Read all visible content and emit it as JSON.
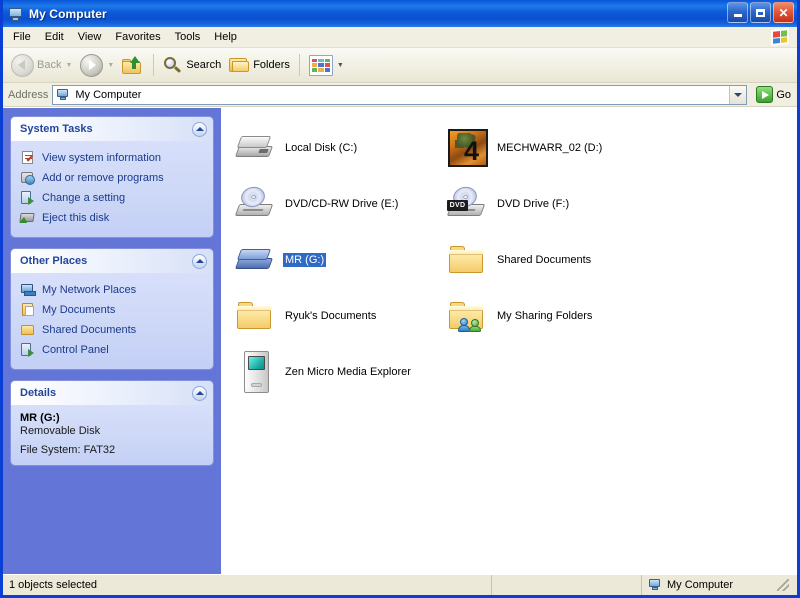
{
  "window": {
    "title": "My Computer",
    "title_icon": "my-computer-icon",
    "minimize_label": "Minimize",
    "maximize_label": "Maximize",
    "close_label": "Close"
  },
  "menubar": {
    "items": [
      {
        "label": "File"
      },
      {
        "label": "Edit"
      },
      {
        "label": "View"
      },
      {
        "label": "Favorites"
      },
      {
        "label": "Tools"
      },
      {
        "label": "Help"
      }
    ],
    "logo": "windows-flag-icon"
  },
  "toolbar": {
    "back_label": "Back",
    "back_icon": "back-arrow-icon",
    "forward_icon": "forward-arrow-icon",
    "up_icon": "up-folder-icon",
    "search_label": "Search",
    "search_icon": "search-icon",
    "folders_label": "Folders",
    "folders_icon": "folders-icon",
    "views_icon": "views-icon"
  },
  "addressbar": {
    "label": "Address",
    "value": "My Computer",
    "icon": "my-computer-icon",
    "dropdown_icon": "chevron-down-icon",
    "go_label": "Go",
    "go_icon": "go-arrow-icon"
  },
  "sidebar": {
    "panels": [
      {
        "title": "System Tasks",
        "collapse_icon": "chevron-up-icon",
        "items": [
          {
            "label": "View system information",
            "icon": "system-information-icon"
          },
          {
            "label": "Add or remove programs",
            "icon": "add-remove-programs-icon"
          },
          {
            "label": "Change a setting",
            "icon": "control-panel-icon"
          },
          {
            "label": "Eject this disk",
            "icon": "eject-disk-icon"
          }
        ]
      },
      {
        "title": "Other Places",
        "collapse_icon": "chevron-up-icon",
        "items": [
          {
            "label": "My Network Places",
            "icon": "network-places-icon"
          },
          {
            "label": "My Documents",
            "icon": "my-documents-icon"
          },
          {
            "label": "Shared Documents",
            "icon": "shared-documents-icon"
          },
          {
            "label": "Control Panel",
            "icon": "control-panel-icon"
          }
        ]
      }
    ],
    "details": {
      "title": "Details",
      "collapse_icon": "chevron-up-icon",
      "name": "MR (G:)",
      "type": "Removable Disk",
      "filesystem": "File System: FAT32"
    }
  },
  "content": {
    "items": [
      {
        "label": "Local Disk (C:)",
        "icon": "hard-disk-icon",
        "selected": false
      },
      {
        "label": "MECHWARR_02 (D:)",
        "icon": "game-disc-icon",
        "selected": false,
        "badge": "4"
      },
      {
        "label": "DVD/CD-RW Drive (E:)",
        "icon": "optical-drive-icon",
        "selected": false
      },
      {
        "label": "DVD Drive (F:)",
        "icon": "dvd-drive-icon",
        "selected": false,
        "badge": "DVD"
      },
      {
        "label": "MR (G:)",
        "icon": "removable-disk-icon",
        "selected": true
      },
      {
        "label": "Shared Documents",
        "icon": "folder-icon",
        "selected": false
      },
      {
        "label": "Ryuk's Documents",
        "icon": "folder-icon",
        "selected": false
      },
      {
        "label": "My Sharing Folders",
        "icon": "shared-folder-icon",
        "selected": false
      },
      {
        "label": "Zen Micro Media Explorer",
        "icon": "media-player-icon",
        "selected": false
      }
    ]
  },
  "statusbar": {
    "selection": "1 objects selected",
    "location": "My Computer",
    "location_icon": "my-computer-icon"
  },
  "colors": {
    "title_blue": "#0a56d6",
    "sidebar_blue": "#6375d6",
    "panel_body": "#cdd8f7",
    "panel_title": "#23459c",
    "selection": "#316ac5",
    "chrome": "#ece9d8"
  }
}
